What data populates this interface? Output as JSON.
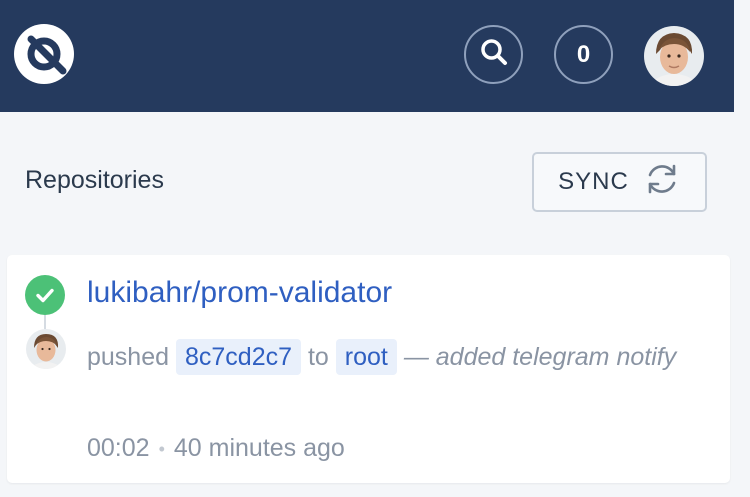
{
  "header": {
    "notification_count": "0",
    "colors": {
      "bg": "#253a5e",
      "icon_border": "#8fa0bc"
    }
  },
  "section": {
    "title": "Repositories",
    "sync_label": "SYNC"
  },
  "build": {
    "repo": "lukibahr/prom-validator",
    "status": "success",
    "action": "pushed",
    "commit": "8c7cd2c7",
    "to": "to",
    "branch": "root",
    "message": "— added telegram notify",
    "duration": "00:02",
    "separator": "•",
    "time_ago": "40 minutes ago",
    "colors": {
      "success": "#4cc177",
      "link": "#2f5fc1"
    }
  }
}
